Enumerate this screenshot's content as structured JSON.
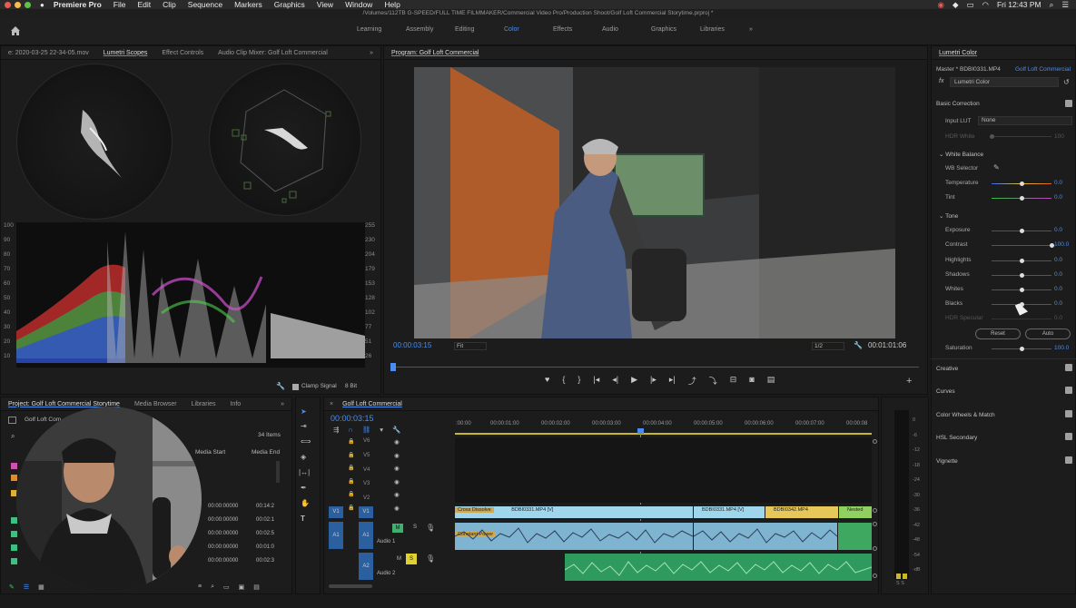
{
  "menubar": {
    "app_name": "Premiere Pro",
    "items": [
      "File",
      "Edit",
      "Clip",
      "Sequence",
      "Markers",
      "Graphics",
      "View",
      "Window",
      "Help"
    ],
    "clock": "Fri 12:43 PM"
  },
  "title": "/Volumes/112TB G-SPEED/FULL TIME FILMMAKER/Commercial Video Pro/Production Shoot/Golf Loft Commercial Storytime.prproj *",
  "workspaces": [
    "Learning",
    "Assembly",
    "Editing",
    "Color",
    "Effects",
    "Audio",
    "Graphics",
    "Libraries"
  ],
  "workspace_active": "Color",
  "scopes_panel": {
    "tabs": [
      "e: 2020-03-25 22-34-05.mov",
      "Lumetri Scopes",
      "Effect Controls",
      "Audio Clip Mixer: Golf Loft Commercial"
    ],
    "left_axis": [
      "100",
      "90",
      "80",
      "70",
      "60",
      "50",
      "40",
      "30",
      "20",
      "10"
    ],
    "right_axis": [
      "255",
      "230",
      "204",
      "179",
      "153",
      "128",
      "102",
      "77",
      "51",
      "26"
    ],
    "clamp_signal": "Clamp Signal",
    "bit_depth": "8 Bit"
  },
  "program": {
    "title": "Program: Golf Loft Commercial",
    "timecode": "00:00:03:15",
    "fit": "Fit",
    "resolution": "1/2",
    "duration": "00:01:01:06"
  },
  "lumetri": {
    "title": "Lumetri Color",
    "master": "Master * BDBI0331.MP4",
    "sequence": "Golf Loft Commercial",
    "effect": "Lumetri Color",
    "basic_correction": "Basic Correction",
    "input_lut_label": "Input LUT",
    "input_lut_value": "None",
    "hdr_white_label": "HDR White",
    "hdr_white_value": "100",
    "white_balance": "White Balance",
    "wb_selector": "WB Selector",
    "tone": "Tone",
    "rows": [
      {
        "label": "Temperature",
        "value": "0.0"
      },
      {
        "label": "Tint",
        "value": "0.0"
      },
      {
        "label": "Exposure",
        "value": "0.0"
      },
      {
        "label": "Contrast",
        "value": "100.0"
      },
      {
        "label": "Highlights",
        "value": "0.0"
      },
      {
        "label": "Shadows",
        "value": "0.0"
      },
      {
        "label": "Whites",
        "value": "0.0"
      },
      {
        "label": "Blacks",
        "value": "0.0"
      },
      {
        "label": "HDR Specular",
        "value": "0.0"
      },
      {
        "label": "Saturation",
        "value": "100.0"
      }
    ],
    "reset": "Reset",
    "auto": "Auto",
    "sections": [
      "Creative",
      "Curves",
      "Color Wheels & Match",
      "HSL Secondary",
      "Vignette"
    ]
  },
  "project": {
    "tabs": [
      "Project: Golf Loft Commercial Storytime",
      "Media Browser",
      "Libraries",
      "Info"
    ],
    "bin": "Golf Loft Com",
    "count": "34 Items",
    "col_start": "Media Start",
    "col_end": "Media End",
    "rows": [
      {
        "start": "00:00:00000",
        "end": "00:14:2"
      },
      {
        "start": "00:00:00000",
        "end": "00:02:1"
      },
      {
        "start": "00:00:00000",
        "end": "00:02:5"
      },
      {
        "start": "00:00:00000",
        "end": "00:01:0"
      },
      {
        "start": "00:00:00000",
        "end": "00:02:3"
      }
    ]
  },
  "timeline": {
    "title": "Golf Loft Commercial",
    "timecode": "00:00:03:15",
    "ruler": [
      ":00:00",
      "00:00:01:00",
      "00:00:02:00",
      "00:00:03:00",
      "00:00:04:00",
      "00:00:05:00",
      "00:00:06:00",
      "00:00:07:00",
      "00:00:08"
    ],
    "tracks": [
      "V6",
      "V5",
      "V4",
      "V3",
      "V2",
      "V1",
      "A1",
      "A2"
    ],
    "src_v1": "V1",
    "src_a1": "A1",
    "audio1": "Audio 1",
    "audio2": "Audio 2",
    "m": "M",
    "s": "S",
    "clips_v": [
      {
        "label": "Cross Dissolve"
      },
      {
        "label": "BDBI0331.MP4 [V]"
      },
      {
        "label": "BDBI0331.MP4 [V]"
      },
      {
        "label": "BDBI0342.MP4"
      },
      {
        "label": "Nested"
      }
    ],
    "clip_audio": "Constant Power"
  },
  "meter": {
    "ticks": [
      "0",
      "-6",
      "-12",
      "-18",
      "-24",
      "-30",
      "-36",
      "-42",
      "-48",
      "-54",
      "-dB"
    ],
    "footer": "S S"
  },
  "colors": {
    "accent": "#4a8cf0",
    "video_clip": "#9fd6ec",
    "audio_clip": "#3aa86a",
    "audio_clip2": "#2f9a5e"
  }
}
